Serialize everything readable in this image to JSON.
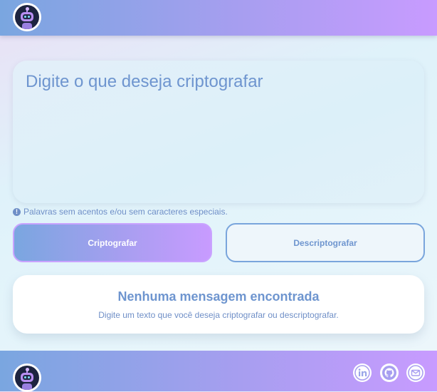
{
  "header": {
    "logo": "robot-logo-icon"
  },
  "editor": {
    "placeholder": "Digite o que deseja criptografar"
  },
  "notice": {
    "icon": "exclamation-icon",
    "text": "Palavras sem acentos e/ou sem caracteres especiais."
  },
  "buttons": {
    "encrypt_label": "Criptografar",
    "decrypt_label": "Descriptografar"
  },
  "message": {
    "title": "Nenhuma mensagem encontrada",
    "subtitle": "Digite um texto que você deseja criptografar ou descriptografar."
  },
  "footer": {
    "logo": "robot-logo-icon",
    "social": [
      "linkedin-icon",
      "github-icon",
      "email-icon"
    ]
  },
  "colors": {
    "accent_start": "#7aa6e0",
    "accent_end": "#c89bff",
    "text_blue": "#6e95cf"
  }
}
